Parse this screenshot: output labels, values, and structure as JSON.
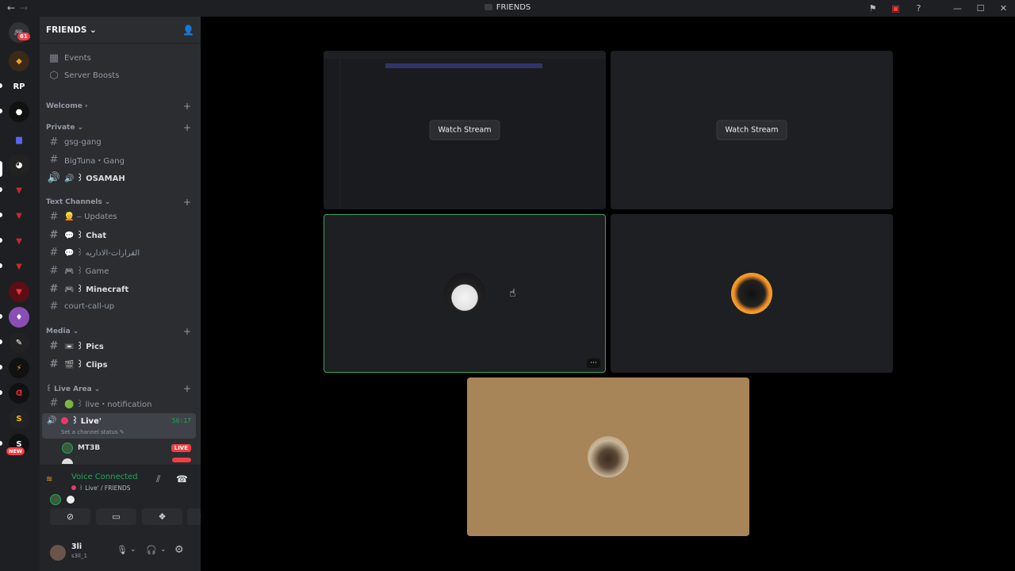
{
  "window": {
    "title": "FRIENDS",
    "nav_back": "←",
    "nav_forward": "→"
  },
  "titlebar_icons": [
    "flag-icon",
    "screen-icon",
    "help-icon",
    "minimize-icon",
    "maximize-icon",
    "close-icon"
  ],
  "servers": {
    "home_badge": "61",
    "rp_label": "RP",
    "new_badge": "NEW"
  },
  "guild": {
    "name": "FRIENDS ⌄"
  },
  "top_items": [
    {
      "label": "Events",
      "icon": "calendar-icon"
    },
    {
      "label": "Server Boosts",
      "icon": "boost-icon"
    }
  ],
  "categories": {
    "welcome": "Welcome ›",
    "private": "Private ⌄",
    "text": "Text Channels ⌄",
    "media": "Media ⌄",
    "live": "꒰ Live Area ⌄"
  },
  "channels": {
    "gsg": "gsg-gang",
    "bigtuna": "BigTuna・Gang",
    "osamah": "🔊 ꒱ OSAMAH",
    "updates": "👱 ‒ Updates",
    "chat": "💬 ꒱ Chat",
    "arabic": "💬 ꒱ القرارات-الاداريه",
    "game": "🎮 ꒱ Game",
    "minecraft": "🎮 ꒱ Minecraft",
    "court": "court-call-up",
    "pics": "📼 ꒱ Pics",
    "clips": "🎬 ꒱ Clips",
    "livenotif": "🟢 ꒱ live・notification"
  },
  "live_channel": {
    "name": "꒱ Live'",
    "timer": "56:17",
    "status": "Set a channel status ✎"
  },
  "voice_users": [
    {
      "name": "MT3B",
      "live": "LIVE"
    }
  ],
  "voice_panel": {
    "status": "Voice Connected",
    "channel": "꒱ Live' / FRIENDS"
  },
  "user": {
    "name": "3li",
    "tag": "s3li_1"
  },
  "stage": {
    "watch_label": "Watch Stream",
    "more": "···"
  },
  "colors": {
    "accent_green": "#23a55a",
    "speaking_border": "#3ba55d",
    "live_red": "#f23f43",
    "tan_tile": "#a88459"
  }
}
